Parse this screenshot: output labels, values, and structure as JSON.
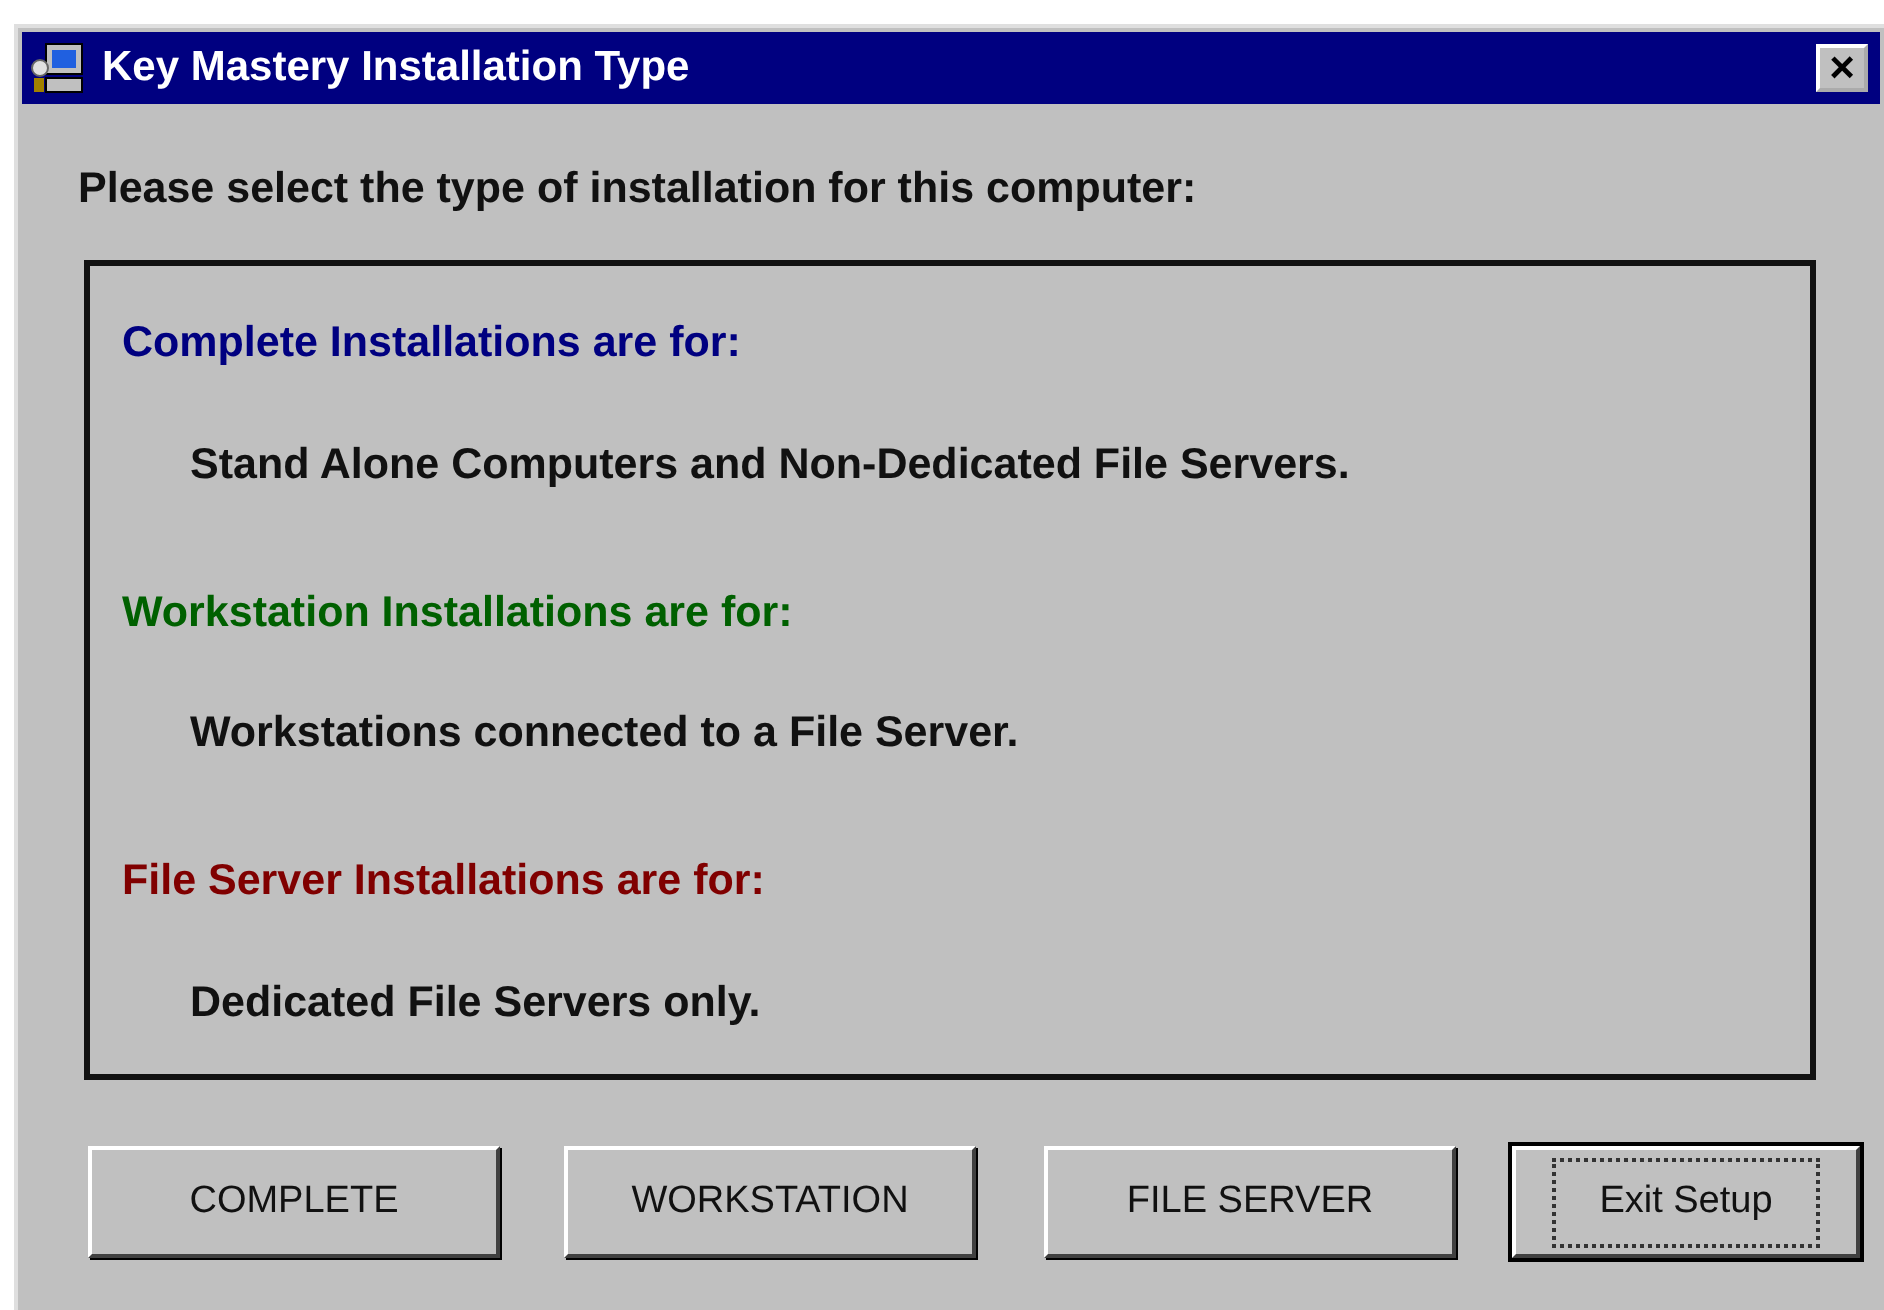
{
  "window": {
    "title": "Key Mastery Installation Type",
    "close": "×"
  },
  "prompt": "Please select the type of installation for this computer:",
  "sections": [
    {
      "heading": "Complete Installations are for:",
      "color": "#000080",
      "text": "Stand Alone Computers and Non-Dedicated File Servers."
    },
    {
      "heading": "Workstation Installations are for:",
      "color": "#006000",
      "text": "Workstations connected to a File Server."
    },
    {
      "heading": "File Server Installations are for:",
      "color": "#800000",
      "text": "Dedicated File Servers only."
    }
  ],
  "buttons": [
    {
      "label": "COMPLETE",
      "focused": false
    },
    {
      "label": "WORKSTATION",
      "focused": false
    },
    {
      "label": "FILE SERVER",
      "focused": false
    },
    {
      "label": "Exit Setup",
      "focused": true
    }
  ]
}
